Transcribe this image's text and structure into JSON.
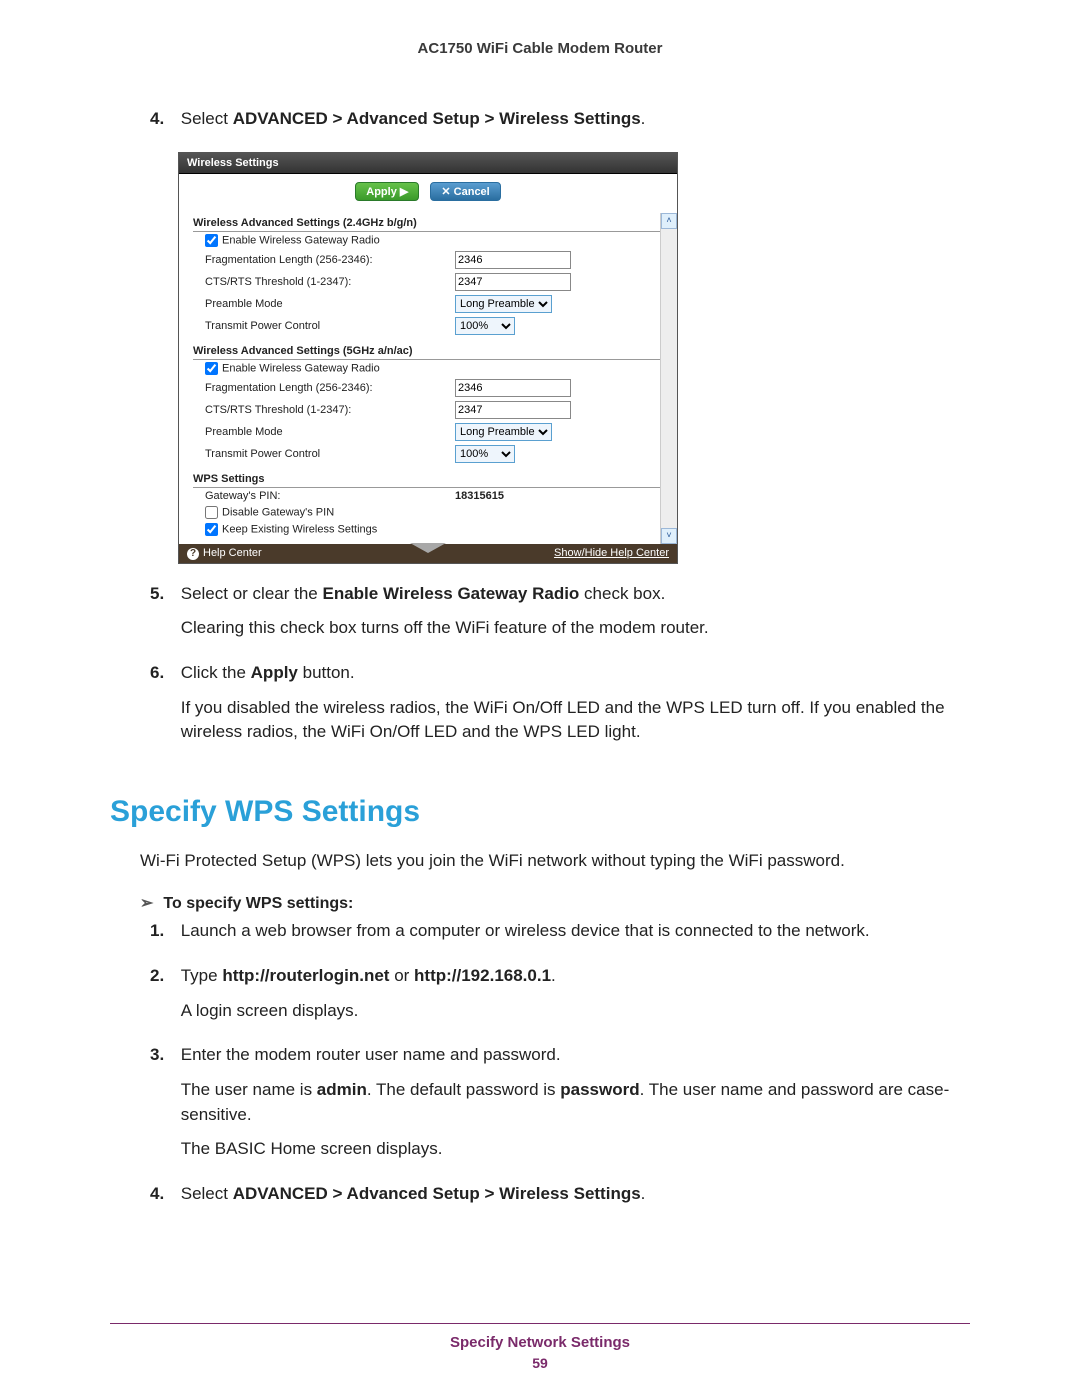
{
  "doc": {
    "product": "AC1750 WiFi Cable Modem Router",
    "footer_section": "Specify Network Settings",
    "page_number": "59"
  },
  "steps_top": {
    "s4": {
      "num": "4.",
      "prefix": "Select ",
      "bold_path": "ADVANCED > Advanced Setup > Wireless Settings",
      "suffix": "."
    },
    "s5": {
      "num": "5.",
      "prefix": "Select or clear the ",
      "bold": "Enable Wireless Gateway Radio",
      "suffix": " check box.",
      "p2": "Clearing this check box turns off the WiFi feature of the modem router."
    },
    "s6": {
      "num": "6.",
      "prefix": "Click the ",
      "bold": "Apply",
      "suffix": " button.",
      "p2": "If you disabled the wireless radios, the WiFi On/Off LED and the WPS LED turn off. If you enabled the wireless radios, the WiFi On/Off LED and the WPS LED light."
    }
  },
  "router": {
    "title": "Wireless Settings",
    "apply_label": "Apply ▶",
    "cancel_label": "✕ Cancel",
    "section24_title": "Wireless Advanced Settings (2.4GHz b/g/n)",
    "section5_title": "Wireless Advanced Settings (5GHz a/n/ac)",
    "cb_enable_label": "Enable Wireless Gateway Radio",
    "frag_label": "Fragmentation Length (256-2346):",
    "cts_label": "CTS/RTS Threshold (1-2347):",
    "preamble_label": "Preamble Mode",
    "txpower_label": "Transmit Power Control",
    "frag_value_24": "2346",
    "cts_value_24": "2347",
    "preamble_value": "Long Preamble",
    "txpower_value": "100%",
    "frag_value_5": "2346",
    "cts_value_5": "2347",
    "wps_title": "WPS Settings",
    "gateway_pin_label": "Gateway's PIN:",
    "gateway_pin_value": "18315615",
    "disable_pin_label": "Disable Gateway's PIN",
    "keep_label": "Keep Existing Wireless Settings",
    "help_center": "Help Center",
    "show_hide": "Show/Hide Help Center"
  },
  "wps_section": {
    "heading": "Specify WPS Settings",
    "intro": "Wi-Fi Protected Setup (WPS) lets you join the WiFi network without typing the WiFi password.",
    "proc_title": "To specify WPS settings:",
    "s1": {
      "num": "1.",
      "text": "Launch a web browser from a computer or wireless device that is connected to the network."
    },
    "s2": {
      "num": "2.",
      "prefix": "Type ",
      "bold1": "http://routerlogin.net",
      "mid": " or ",
      "bold2": "http://192.168.0.1",
      "suffix": ".",
      "p2": "A login screen displays."
    },
    "s3": {
      "num": "3.",
      "text": "Enter the modem router user name and password.",
      "p2a": "The user name is ",
      "p2b": "admin",
      "p2c": ". The default password is ",
      "p2d": "password",
      "p2e": ". The user name and password are case-sensitive.",
      "p3": "The BASIC Home screen displays."
    },
    "s4": {
      "num": "4.",
      "prefix": "Select ",
      "bold_path": "ADVANCED > Advanced Setup > Wireless Settings",
      "suffix": "."
    }
  }
}
